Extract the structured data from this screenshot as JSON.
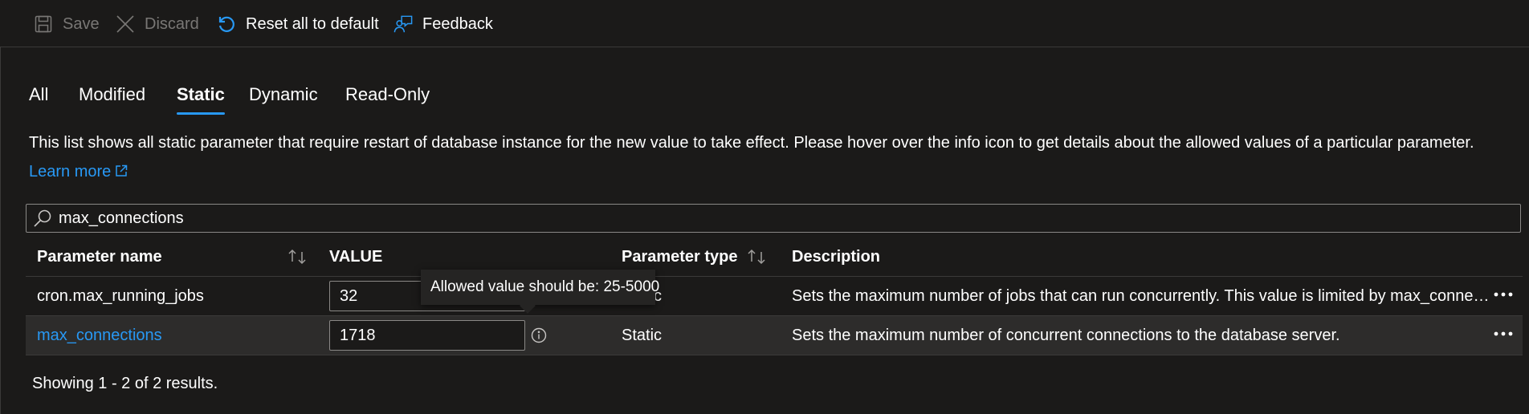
{
  "toolbar": {
    "save_label": "Save",
    "discard_label": "Discard",
    "reset_label": "Reset all to default",
    "feedback_label": "Feedback"
  },
  "tabs": [
    {
      "label": "All",
      "active": false
    },
    {
      "label": "Modified",
      "active": false
    },
    {
      "label": "Static",
      "active": true
    },
    {
      "label": "Dynamic",
      "active": false
    },
    {
      "label": "Read-Only",
      "active": false
    }
  ],
  "info": {
    "text": "This list shows all static parameter that require restart of database instance for the new value to take effect. Please hover over the info icon to get details about the allowed values of a particular parameter. ",
    "learn_more": "Learn more"
  },
  "search": {
    "value": "max_connections"
  },
  "table": {
    "headers": {
      "name": "Parameter name",
      "value": "VALUE",
      "type": "Parameter type",
      "description": "Description"
    },
    "rows": [
      {
        "name": "cron.max_running_jobs",
        "value": "32",
        "type": "Static",
        "description": "Sets the maximum number of jobs that can run concurrently. This value is limited by max_connect...",
        "selected": false,
        "name_is_link": false
      },
      {
        "name": "max_connections",
        "value": "1718",
        "type": "Static",
        "description": "Sets the maximum number of concurrent connections to the database server.",
        "selected": true,
        "name_is_link": true
      }
    ]
  },
  "tooltip": {
    "text": "Allowed value should be: 25-5000"
  },
  "footer": {
    "text": "Showing 1 - 2 of 2 results."
  },
  "colors": {
    "background": "#1b1a19",
    "accent": "#2899f5",
    "disabled": "#797775"
  },
  "icons": {
    "save": "save-icon",
    "discard": "close-icon",
    "reset": "reset-icon",
    "feedback": "feedback-icon",
    "search": "search-icon",
    "external": "external-link-icon",
    "info": "info-icon",
    "sort": "sort-icon",
    "more": "more-options-icon"
  }
}
